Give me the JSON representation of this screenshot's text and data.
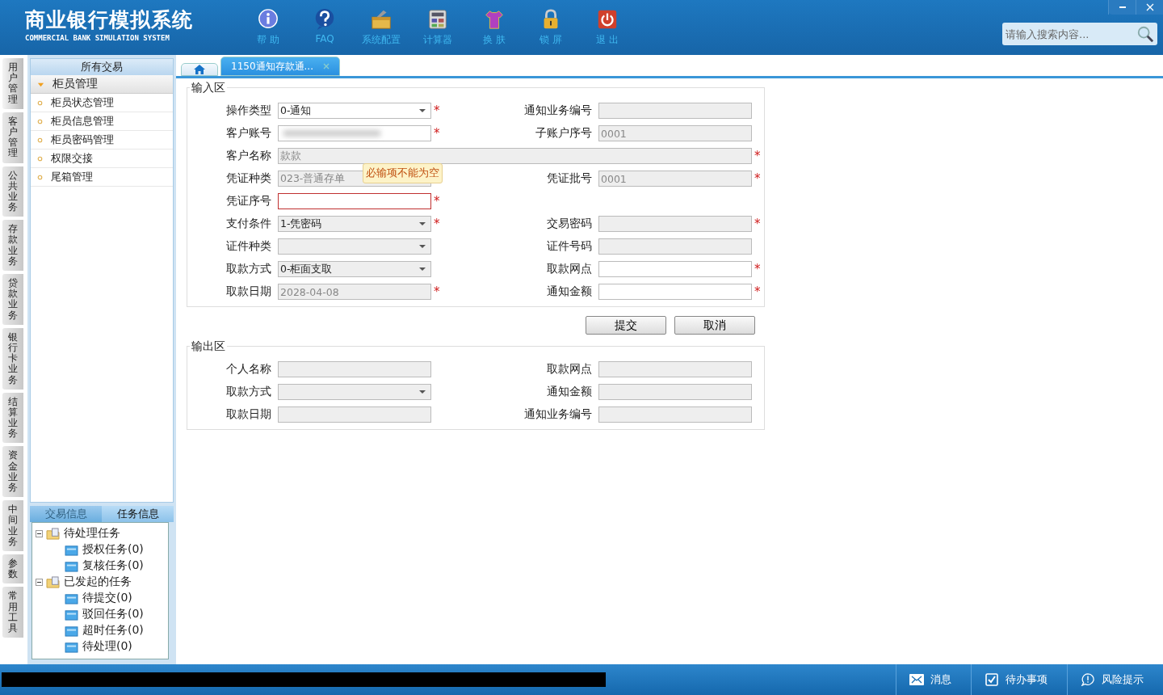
{
  "header": {
    "title": "商业银行模拟系统",
    "subtitle": "COMMERCIAL BANK SIMULATION SYSTEM",
    "toolbar": [
      {
        "label": "帮 助",
        "kind": "info"
      },
      {
        "label": "FAQ",
        "kind": "help"
      },
      {
        "label": "系统配置",
        "kind": "tools"
      },
      {
        "label": "计算器",
        "kind": "calculator"
      },
      {
        "label": "换 肤",
        "kind": "shirt"
      },
      {
        "label": "锁 屏",
        "kind": "lock"
      },
      {
        "label": "退 出",
        "kind": "power"
      }
    ],
    "search": {
      "placeholder": "请输入搜索内容..."
    }
  },
  "rail": [
    {
      "label": "用户管理",
      "selected": true
    },
    {
      "label": "客户管理",
      "selected": false
    },
    {
      "label": "公共业务",
      "selected": false
    },
    {
      "label": "存款业务",
      "selected": false
    },
    {
      "label": "贷款业务",
      "selected": false
    },
    {
      "label": "银行卡业务",
      "selected": false
    },
    {
      "label": "结算业务",
      "selected": false
    },
    {
      "label": "资金业务",
      "selected": false
    },
    {
      "label": "中间业务",
      "selected": false
    },
    {
      "label": "参数",
      "selected": false
    },
    {
      "label": "常用工具",
      "selected": false
    }
  ],
  "sidebar": {
    "title": "所有交易",
    "group": {
      "label": "柜员管理",
      "expanded": true
    },
    "items": [
      "柜员状态管理",
      "柜员信息管理",
      "柜员密码管理",
      "权限交接",
      "尾箱管理"
    ],
    "tabs": [
      {
        "label": "交易信息",
        "selected": false
      },
      {
        "label": "任务信息",
        "selected": true
      }
    ],
    "tree": [
      {
        "label": "待处理任务",
        "children": [
          {
            "label": "授权任务(0)"
          },
          {
            "label": "复核任务(0)"
          }
        ]
      },
      {
        "label": "已发起的任务",
        "children": [
          {
            "label": "待提交(0)"
          },
          {
            "label": "驳回任务(0)"
          },
          {
            "label": "超时任务(0)"
          },
          {
            "label": "待处理(0)"
          }
        ]
      }
    ]
  },
  "tabs": [
    {
      "kind": "home",
      "selected": false
    },
    {
      "kind": "page",
      "label": "1150通知存款通...",
      "selected": true
    }
  ],
  "input_area": {
    "title": "输入区",
    "rows": [
      [
        {
          "label": "操作类型",
          "kind": "select",
          "value": "0-通知",
          "disabled": false,
          "required_mark": "*"
        },
        {
          "label": "通知业务编号",
          "kind": "text",
          "disabled": true
        }
      ],
      [
        {
          "label": "客户账号",
          "kind": "blurred",
          "disabled": false,
          "required_mark": "*"
        },
        {
          "label": "子账户序号",
          "kind": "text",
          "value": "0001",
          "disabled": true
        }
      ],
      [
        {
          "label": "客户名称",
          "kind": "wide",
          "value": "款款",
          "disabled": true,
          "required_mark": "*"
        }
      ],
      [
        {
          "label": "凭证种类",
          "kind": "text",
          "value": "023-普通存单",
          "disabled": true
        },
        {
          "label": "凭证批号",
          "kind": "text",
          "value": "0001",
          "disabled": true,
          "required_mark": "*"
        }
      ],
      [
        {
          "label": "凭证序号",
          "kind": "text",
          "disabled": false,
          "required_mark": "*",
          "error": true,
          "tooltip": "必输项不能为空"
        }
      ],
      [
        {
          "label": "支付条件",
          "kind": "select",
          "value": "1-凭密码",
          "disabled": true,
          "required_mark": "*"
        },
        {
          "label": "交易密码",
          "kind": "text",
          "disabled": true,
          "required_mark": "*"
        }
      ],
      [
        {
          "label": "证件种类",
          "kind": "select",
          "disabled": true
        },
        {
          "label": "证件号码",
          "kind": "text",
          "disabled": true
        }
      ],
      [
        {
          "label": "取款方式",
          "kind": "select",
          "value": "0-柜面支取",
          "disabled": true
        },
        {
          "label": "取款网点",
          "kind": "text",
          "disabled": false,
          "required_mark": "*"
        }
      ],
      [
        {
          "label": "取款日期",
          "kind": "text",
          "value": "2028-04-08",
          "disabled": true,
          "required_mark": "*"
        },
        {
          "label": "通知金额",
          "kind": "text",
          "disabled": false,
          "required_mark": "*"
        }
      ]
    ]
  },
  "buttons": [
    "提交",
    "取消"
  ],
  "output_area": {
    "title": "输出区",
    "rows": [
      [
        {
          "label": "个人名称",
          "kind": "text",
          "disabled": true
        },
        {
          "label": "取款网点",
          "kind": "text",
          "disabled": true
        }
      ],
      [
        {
          "label": "取款方式",
          "kind": "select",
          "disabled": true
        },
        {
          "label": "通知金额",
          "kind": "text",
          "disabled": true
        }
      ],
      [
        {
          "label": "取款日期",
          "kind": "text",
          "disabled": true
        },
        {
          "label": "通知业务编号",
          "kind": "text",
          "disabled": true
        }
      ]
    ]
  },
  "status_bar": [
    {
      "label": "消息",
      "kind": "mail"
    },
    {
      "label": "待办事项",
      "kind": "check"
    },
    {
      "label": "风险提示",
      "kind": "alert"
    }
  ]
}
